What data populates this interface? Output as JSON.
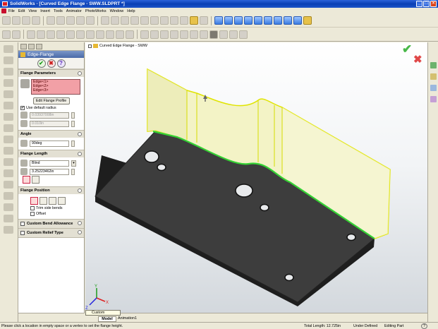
{
  "window": {
    "title": "SolidWorks - [Curved Edge Flange - SWW.SLDPRT *]",
    "min": "_",
    "max": "□",
    "close": "×"
  },
  "menu": {
    "items": [
      "File",
      "Edit",
      "View",
      "Insert",
      "Tools",
      "Animator",
      "PhotoWorks",
      "Window",
      "Help"
    ]
  },
  "property_manager": {
    "feature_title": "Edge-Flange",
    "ok": "✔",
    "cancel": "✖",
    "help": "?",
    "flange_parameters": {
      "header": "Flange Parameters",
      "edges": [
        "Edge<1>",
        "Edge<2>",
        "Edge<3>"
      ],
      "edit_profile_label": "Edit Flange Profile",
      "use_default_radius_label": "Use default radius",
      "use_default_radius_checked": "✔",
      "radius_value": "0.03937008in",
      "gap_value": "0.010in"
    },
    "angle": {
      "header": "Angle",
      "value": "90deg"
    },
    "flange_length": {
      "header": "Flange Length",
      "end_condition": "Blind",
      "value": "3.25223462in"
    },
    "flange_position": {
      "header": "Flange Position",
      "trim_side_bends_label": "Trim side bends",
      "offset_label": "Offset"
    },
    "custom_bend_allowance": {
      "header": "Custom Bend Allowance"
    },
    "custom_relief_type": {
      "header": "Custom Relief Type"
    }
  },
  "graphics": {
    "tree_label": "Curved Edge Flange - SWW",
    "ok_mark": "✔",
    "cancel_mark": "✖",
    "triad": {
      "x": "X",
      "y": "Y",
      "z": "Z"
    },
    "colors": {
      "plate": "#3b3b3b",
      "flange": "#f4f4c4",
      "highlight": "#e8f000",
      "edge_select": "#34d234"
    }
  },
  "bottom": {
    "config": "Custom",
    "tabs": [
      "Model",
      "Animation1"
    ]
  },
  "status": {
    "message": "Please click a location in empty space or a vertex to set the flange height.",
    "total_length": "Total Length: 12.725in",
    "definition": "Under Defined",
    "mode": "Editing Part",
    "help": "?"
  }
}
